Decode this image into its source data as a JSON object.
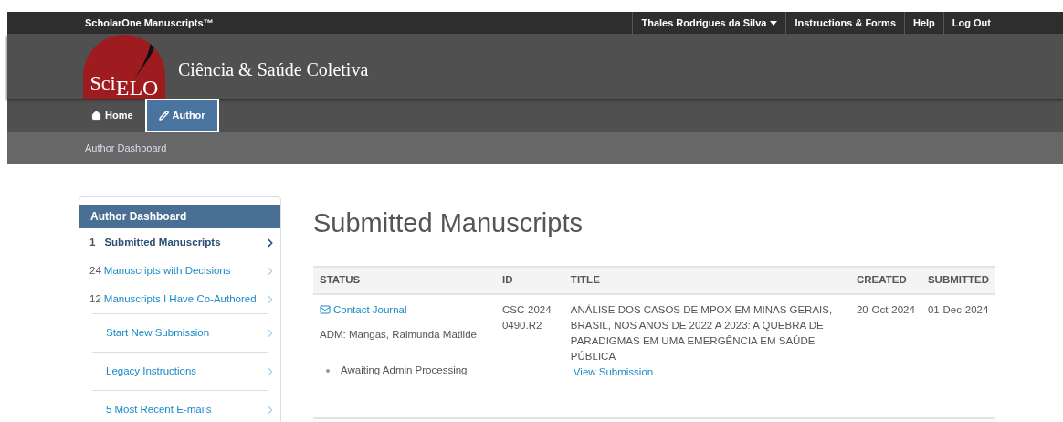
{
  "top_bar": {
    "brand": "ScholarOne Manuscripts™",
    "links": [
      {
        "label": "Thales Rodrigues da Silva",
        "kind": "dropdown"
      },
      {
        "label": "Instructions & Forms",
        "kind": "link"
      },
      {
        "label": "Help",
        "kind": "link"
      },
      {
        "label": "Log Out",
        "kind": "link"
      }
    ]
  },
  "header": {
    "logo": {
      "first": "Sci",
      "second": "ELO"
    },
    "journal": "Ciência & Saúde Coletiva"
  },
  "nav_tabs": [
    {
      "label": "Home",
      "selected": false
    },
    {
      "label": "Author",
      "selected": true
    }
  ],
  "breadcrumb": "Author Dashboard",
  "sidebar": {
    "title": "Author Dashboard",
    "items": [
      {
        "count": "1",
        "label": "Submitted Manuscripts",
        "selected": true,
        "kind": "list"
      },
      {
        "count": "24",
        "label": "Manuscripts with Decisions",
        "selected": false,
        "kind": "list"
      },
      {
        "count": "12",
        "label": "Manuscripts I Have Co-Authored",
        "selected": false,
        "kind": "list"
      },
      {
        "label": "Start New Submission",
        "selected": false,
        "kind": "action"
      },
      {
        "label": "Legacy Instructions",
        "selected": false,
        "kind": "action"
      },
      {
        "count": "5",
        "label": "Most Recent E-mails",
        "selected": false,
        "kind": "action"
      }
    ]
  },
  "page_title": "Submitted Manuscripts",
  "table": {
    "columns": [
      "STATUS",
      "ID",
      "TITLE",
      "CREATED",
      "SUBMITTED"
    ],
    "rows": [
      {
        "contact": "Contact Journal",
        "admin": "ADM: Mangas, Raimunda Matilde",
        "status": "Awaiting Admin Processing",
        "id": "CSC-2024-0490.R2",
        "title": "ANÁLISE DOS CASOS DE MPOX EM MINAS GERAIS, BRASIL, NOS ANOS DE 2022 A 2023: A QUEBRA DE PARADIGMAS EM UMA EMERGÊNCIA EM SAÚDE PÚBLICA",
        "link": "View Submission",
        "created": "20-Oct-2024",
        "submitted": "01-Dec-2024"
      }
    ]
  }
}
